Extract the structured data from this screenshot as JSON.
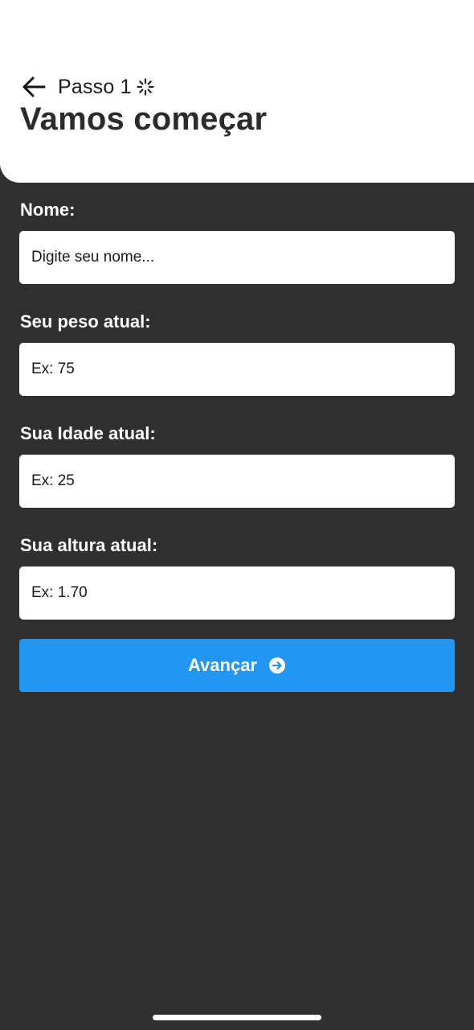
{
  "header": {
    "step_label": "Passo 1",
    "title": "Vamos começar",
    "back_icon": "arrow-left-icon",
    "step_icon": "spinner-icon"
  },
  "form": {
    "fields": [
      {
        "label": "Nome:",
        "placeholder": "Digite seu nome...",
        "value": ""
      },
      {
        "label": "Seu peso atual:",
        "placeholder": "Ex: 75",
        "value": ""
      },
      {
        "label": "Sua Idade atual:",
        "placeholder": "Ex: 25",
        "value": ""
      },
      {
        "label": "Sua altura atual:",
        "placeholder": "Ex: 1.70",
        "value": ""
      }
    ],
    "submit_label": "Avançar",
    "submit_icon": "arrow-right-circle-icon"
  },
  "colors": {
    "background": "#2f2f2f",
    "header_background": "#ffffff",
    "accent": "#2196f3",
    "label_text": "#ffffff",
    "title_text": "#2b2b2b"
  }
}
